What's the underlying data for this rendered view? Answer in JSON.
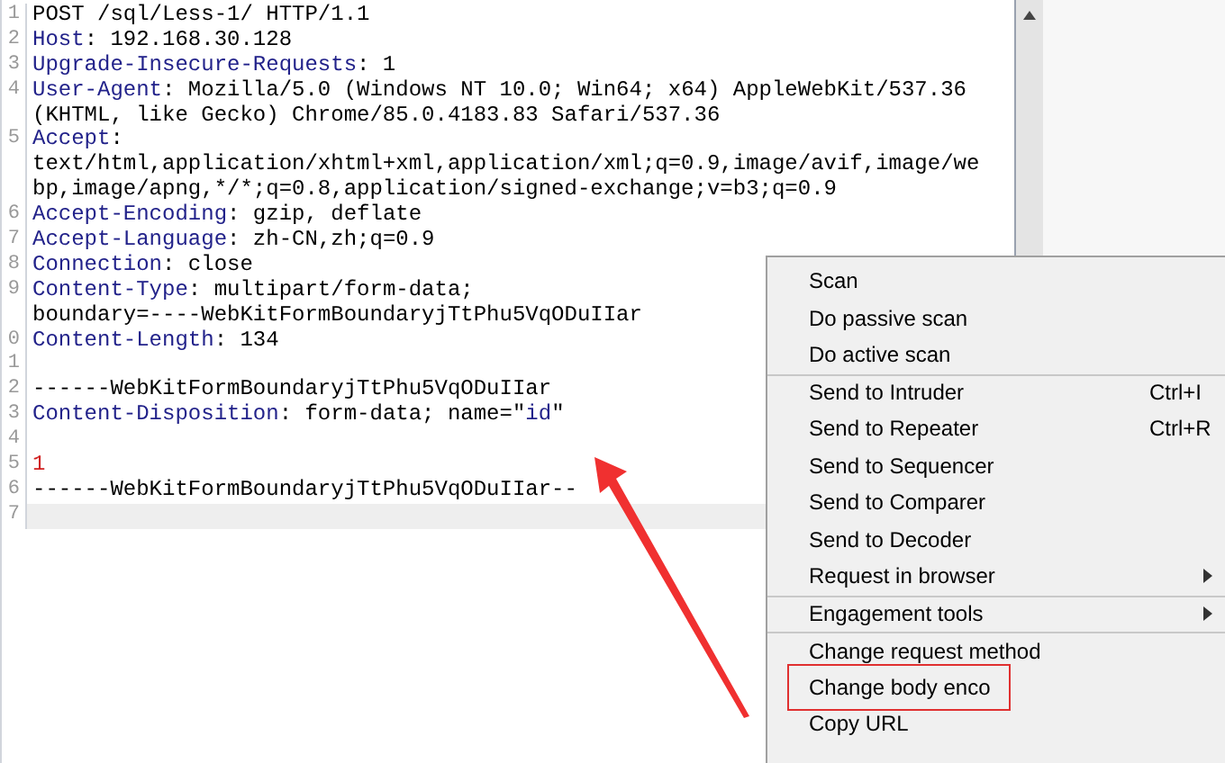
{
  "editor": {
    "rows": [
      {
        "number": "1",
        "current": false,
        "segments": [
          {
            "kind": "plain",
            "text": "POST /sql/Less-1/ HTTP/1.1"
          }
        ]
      },
      {
        "number": "2",
        "current": false,
        "segments": [
          {
            "kind": "name",
            "text": "Host"
          },
          {
            "kind": "plain",
            "text": ": 192.168.30.128"
          }
        ]
      },
      {
        "number": "3",
        "current": false,
        "segments": [
          {
            "kind": "name",
            "text": "Upgrade-Insecure-Requests"
          },
          {
            "kind": "plain",
            "text": ": 1"
          }
        ]
      },
      {
        "number": "4",
        "current": false,
        "segments": [
          {
            "kind": "name",
            "text": "User-Agent"
          },
          {
            "kind": "plain",
            "text": ": Mozilla/5.0 (Windows NT 10.0; Win64; x64) AppleWebKit/537.36"
          }
        ]
      },
      {
        "current": false,
        "segments": [
          {
            "kind": "plain",
            "text": "(KHTML, like Gecko) Chrome/85.0.4183.83 Safari/537.36"
          }
        ]
      },
      {
        "number": "5",
        "current": false,
        "segments": [
          {
            "kind": "name",
            "text": "Accept"
          },
          {
            "kind": "plain",
            "text": ":"
          }
        ]
      },
      {
        "current": false,
        "segments": [
          {
            "kind": "plain",
            "text": "text/html,application/xhtml+xml,application/xml;q=0.9,image/avif,image/we"
          }
        ]
      },
      {
        "current": false,
        "segments": [
          {
            "kind": "plain",
            "text": "bp,image/apng,*/*;q=0.8,application/signed-exchange;v=b3;q=0.9"
          }
        ]
      },
      {
        "number": "6",
        "current": false,
        "segments": [
          {
            "kind": "name",
            "text": "Accept-Encoding"
          },
          {
            "kind": "plain",
            "text": ": gzip, deflate"
          }
        ]
      },
      {
        "number": "7",
        "current": false,
        "segments": [
          {
            "kind": "name",
            "text": "Accept-Language"
          },
          {
            "kind": "plain",
            "text": ": zh-CN,zh;q=0.9"
          }
        ]
      },
      {
        "number": "8",
        "current": false,
        "segments": [
          {
            "kind": "name",
            "text": "Connection"
          },
          {
            "kind": "plain",
            "text": ": close"
          }
        ]
      },
      {
        "number": "9",
        "current": false,
        "segments": [
          {
            "kind": "name",
            "text": "Content-Type"
          },
          {
            "kind": "plain",
            "text": ": multipart/form-data;"
          }
        ]
      },
      {
        "current": false,
        "segments": [
          {
            "kind": "plain",
            "text": "boundary=----WebKitFormBoundaryjTtPhu5VqODuIIar"
          }
        ]
      },
      {
        "number": "0",
        "current": false,
        "segments": [
          {
            "kind": "name",
            "text": "Content-Length"
          },
          {
            "kind": "plain",
            "text": ": 134"
          }
        ]
      },
      {
        "number": "1",
        "current": false,
        "segments": []
      },
      {
        "number": "2",
        "current": false,
        "segments": [
          {
            "kind": "plain",
            "text": "------WebKitFormBoundaryjTtPhu5VqODuIIar"
          }
        ]
      },
      {
        "number": "3",
        "current": false,
        "segments": [
          {
            "kind": "name",
            "text": "Content-Disposition"
          },
          {
            "kind": "plain",
            "text": ": form-data; name=\""
          },
          {
            "kind": "name",
            "text": "id"
          },
          {
            "kind": "plain",
            "text": "\""
          }
        ]
      },
      {
        "number": "4",
        "current": false,
        "segments": []
      },
      {
        "number": "5",
        "current": false,
        "segments": [
          {
            "kind": "value",
            "text": "1"
          }
        ]
      },
      {
        "number": "6",
        "current": false,
        "segments": [
          {
            "kind": "plain",
            "text": "------WebKitFormBoundaryjTtPhu5VqODuIIar--"
          }
        ]
      },
      {
        "number": "7",
        "current": true,
        "segments": []
      }
    ]
  },
  "context_menu": {
    "items": [
      {
        "label": "Scan",
        "separator_before": false,
        "highlighted": false
      },
      {
        "label": "Do passive scan",
        "separator_before": false,
        "highlighted": false
      },
      {
        "label": "Do active scan",
        "separator_before": false,
        "highlighted": false
      },
      {
        "label": "Send to Intruder",
        "shortcut": "Ctrl+I",
        "separator_before": true,
        "highlighted": false
      },
      {
        "label": "Send to Repeater",
        "shortcut": "Ctrl+R",
        "separator_before": false,
        "highlighted": false
      },
      {
        "label": "Send to Sequencer",
        "separator_before": false,
        "highlighted": false
      },
      {
        "label": "Send to Comparer",
        "separator_before": false,
        "highlighted": false
      },
      {
        "label": "Send to Decoder",
        "separator_before": false,
        "highlighted": false
      },
      {
        "label": "Request in browser",
        "submenu": true,
        "separator_before": false,
        "highlighted": false
      },
      {
        "label": "Engagement tools",
        "submenu": true,
        "separator_before": true,
        "highlighted": false
      },
      {
        "label": "Change request method",
        "separator_before": true,
        "highlighted": false
      },
      {
        "label": "Change body enco",
        "separator_before": false,
        "highlighted": true
      },
      {
        "label": "Copy URL",
        "separator_before": false,
        "highlighted": false
      }
    ]
  }
}
